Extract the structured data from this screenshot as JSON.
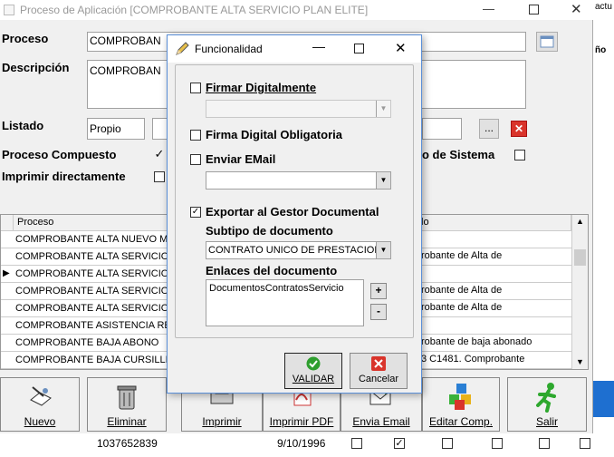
{
  "background": {
    "labels": [
      "actu",
      "ño"
    ]
  },
  "main": {
    "title": "Proceso de Aplicación [COMPROBANTE ALTA SERVICIO PLAN ELITE]",
    "proceso_label": "Proceso",
    "proceso_value": "COMPROBAN",
    "descripcion_label": "Descripción",
    "descripcion_value": "COMPROBAN",
    "listado_label": "Listado",
    "listado_value": "Propio",
    "listado_btn": "...",
    "proceso_compuesto_label": "Proceso Compuesto",
    "proceso_compuesto_checked": "✓",
    "de_sistema_label": "o de Sistema",
    "imprimir_label": "Imprimir directamente"
  },
  "grid": {
    "headers": [
      "Proceso",
      "lo"
    ],
    "rows": [
      {
        "name": "COMPROBANTE ALTA NUEVO M",
        "desc": "",
        "ind": ""
      },
      {
        "name": "COMPROBANTE ALTA SERVICIO",
        "desc": "robante de Alta de",
        "ind": ""
      },
      {
        "name": "COMPROBANTE ALTA SERVICIO",
        "desc": "",
        "ind": "▶"
      },
      {
        "name": "COMPROBANTE ALTA SERVICIO",
        "desc": "robante de Alta de",
        "ind": ""
      },
      {
        "name": "COMPROBANTE ALTA SERVICIO",
        "desc": "robante de Alta de",
        "ind": ""
      },
      {
        "name": "COMPROBANTE ASISTENCIA RE",
        "desc": "",
        "ind": ""
      },
      {
        "name": "COMPROBANTE BAJA ABONO",
        "desc": "robante de baja abonado",
        "ind": ""
      },
      {
        "name": "COMPROBANTE BAJA CURSILLIS",
        "desc": "3 C1481. Comprobante",
        "ind": ""
      }
    ]
  },
  "toolbar": {
    "nuevo": "Nuevo",
    "eliminar": "Eliminar",
    "imprimir": "Imprimir",
    "imprimir_pdf": "Imprimir PDF",
    "envia_email": "Envia Email",
    "editar": "Editar Comp.",
    "salir": "Salir"
  },
  "bottom": {
    "code": "1037652839",
    "date": "9/10/1996",
    "check": "✓"
  },
  "dialog": {
    "title": "Funcionalidad",
    "firmar": "Firmar Digitalmente",
    "firma_obligatoria": "Firma Digital Obligatoria",
    "enviar_email": "Enviar EMail",
    "exportar": "Exportar al Gestor Documental",
    "exportar_checked": "✓",
    "subtipo_label": "Subtipo de documento",
    "subtipo_value": "CONTRATO UNICO DE PRESTACION",
    "enlaces_label": "Enlaces del documento",
    "enlace_item": "DocumentosContratosServicio",
    "plus": "+",
    "minus": "-",
    "validar": "VALIDAR",
    "cancelar": "Cancelar"
  },
  "colors": {
    "accent": "#5a8fd8",
    "validar_green": "#2e9e2e",
    "cancel_red": "#d9342b"
  }
}
